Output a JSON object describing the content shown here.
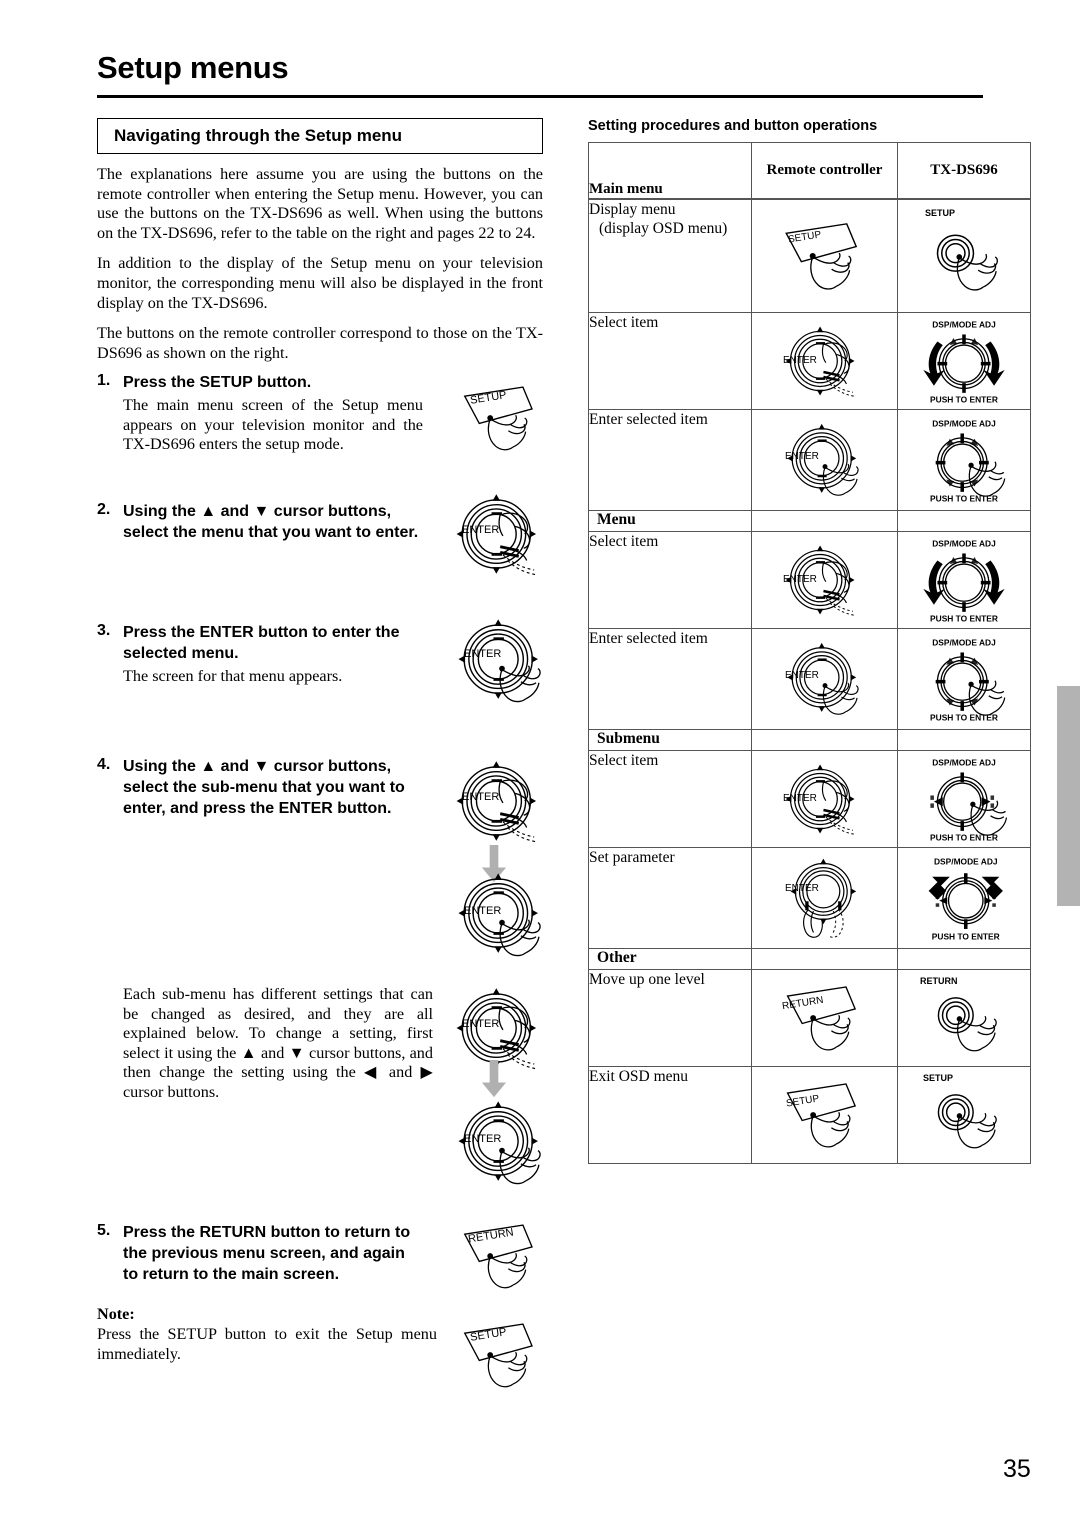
{
  "page": {
    "title": "Setup menus",
    "number": "35"
  },
  "left": {
    "section_heading": "Navigating through the Setup menu",
    "paragraphs": [
      "The explanations here assume you are using the buttons on the remote controller when entering the Setup menu. However, you can use the buttons on the TX-DS696 as well. When using the buttons on the TX-DS696, refer to the table on the right and pages 22 to 24.",
      "In addition to the display of the Setup menu on your television monitor, the corresponding menu will also be displayed in the front display on the TX-DS696.",
      "The buttons on the remote controller correspond to those on the TX-DS696 as shown on the right."
    ],
    "steps": [
      {
        "num": "1.",
        "head": "Press the SETUP button.",
        "sub": "The main menu screen of the Setup menu appears on your television monitor and the TX-DS696 enters the setup mode.",
        "icons": [
          "setup-button"
        ]
      },
      {
        "num": "2.",
        "head": "Using the ▲ and ▼ cursor buttons, select the menu that you want to enter.",
        "sub": "",
        "icons": [
          "enter-dial-updown"
        ]
      },
      {
        "num": "3.",
        "head": "Press the ENTER button to enter the selected menu.",
        "sub": "The screen for that menu appears.",
        "icons": [
          "enter-dial-press"
        ]
      },
      {
        "num": "4.",
        "head": "Using the ▲ and ▼ cursor buttons, select the sub-menu that you want to enter, and press the ENTER button.",
        "sub": "",
        "icons": [
          "enter-dial-updown",
          "down-arrow",
          "enter-dial-press"
        ]
      },
      {
        "num": "5.",
        "head": "Press the RETURN button to return to the previous menu screen, and again to return to the main screen.",
        "sub": "",
        "icons": [
          "return-button"
        ]
      }
    ],
    "submenu_paragraph": "Each sub-menu has different settings that can be changed as desired, and they are all explained below. To change a setting, first select it using the ▲ and ▼ cursor buttons, and then change the setting using the ◀ and ▶ cursor buttons.",
    "note": {
      "label": "Note:",
      "text": "Press the SETUP button to exit the Setup menu immediately."
    }
  },
  "right": {
    "caption": "Setting procedures and button operations",
    "headers": {
      "col1": "",
      "col2": "Remote controller",
      "col3": "TX-DS696"
    },
    "groups": [
      {
        "label": "Main menu",
        "rows": [
          {
            "label": "Display menu",
            "label2": "(display OSD menu)",
            "remote": "setup-button",
            "unit": "setup-knob"
          },
          {
            "label": "Select item",
            "label2": "",
            "remote": "enter-dial-updown",
            "unit": "dial-rotate-vertical"
          },
          {
            "label": "Enter selected item",
            "label2": "",
            "remote": "enter-dial-press",
            "unit": "dial-push-vertical"
          }
        ]
      },
      {
        "label": "Menu",
        "rows": [
          {
            "label": "Select item",
            "label2": "",
            "remote": "enter-dial-updown",
            "unit": "dial-rotate-vertical"
          },
          {
            "label": "Enter selected item",
            "label2": "",
            "remote": "enter-dial-press",
            "unit": "dial-push-vertical"
          }
        ]
      },
      {
        "label": "Submenu",
        "rows": [
          {
            "label": "Select item",
            "label2": "",
            "remote": "enter-dial-updown",
            "unit": "dial-push-horizontal"
          },
          {
            "label": "Set parameter",
            "label2": "",
            "remote": "enter-dial-leftright",
            "unit": "dial-rotate-horizontal"
          }
        ]
      },
      {
        "label": "Other",
        "rows": [
          {
            "label": "Move up one level",
            "label2": "",
            "remote": "return-button",
            "unit": "return-knob"
          },
          {
            "label": "Exit OSD menu",
            "label2": "",
            "remote": "setup-button",
            "unit": "setup-knob"
          }
        ]
      }
    ],
    "dial_labels": {
      "top": "DSP/MODE ADJ",
      "bottom": "PUSH TO ENTER"
    },
    "button_labels": {
      "setup": "SETUP",
      "return": "RETURN",
      "enter": "ENTER"
    }
  }
}
